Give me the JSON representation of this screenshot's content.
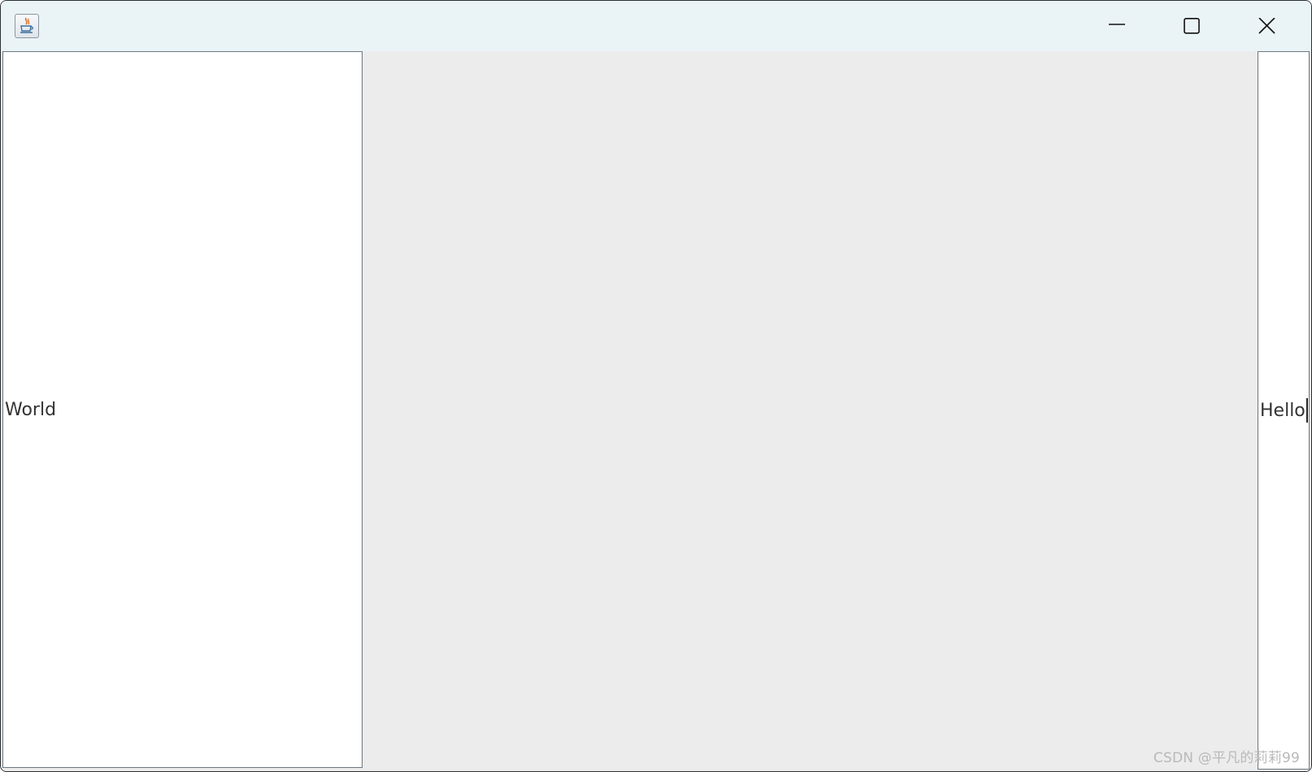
{
  "window": {
    "app_icon": "java-coffee-cup-icon",
    "controls": {
      "minimize_icon": "minimize-icon",
      "maximize_icon": "maximize-icon",
      "close_icon": "close-icon"
    }
  },
  "west_text": {
    "value": "World"
  },
  "east_text": {
    "value": "Hello"
  },
  "watermark": "CSDN @平凡的莉莉99",
  "colors": {
    "titlebar": "#eaf3f6",
    "client_background": "#ececec",
    "text_area_background": "#ffffff",
    "text_area_border": "#6c7780"
  }
}
